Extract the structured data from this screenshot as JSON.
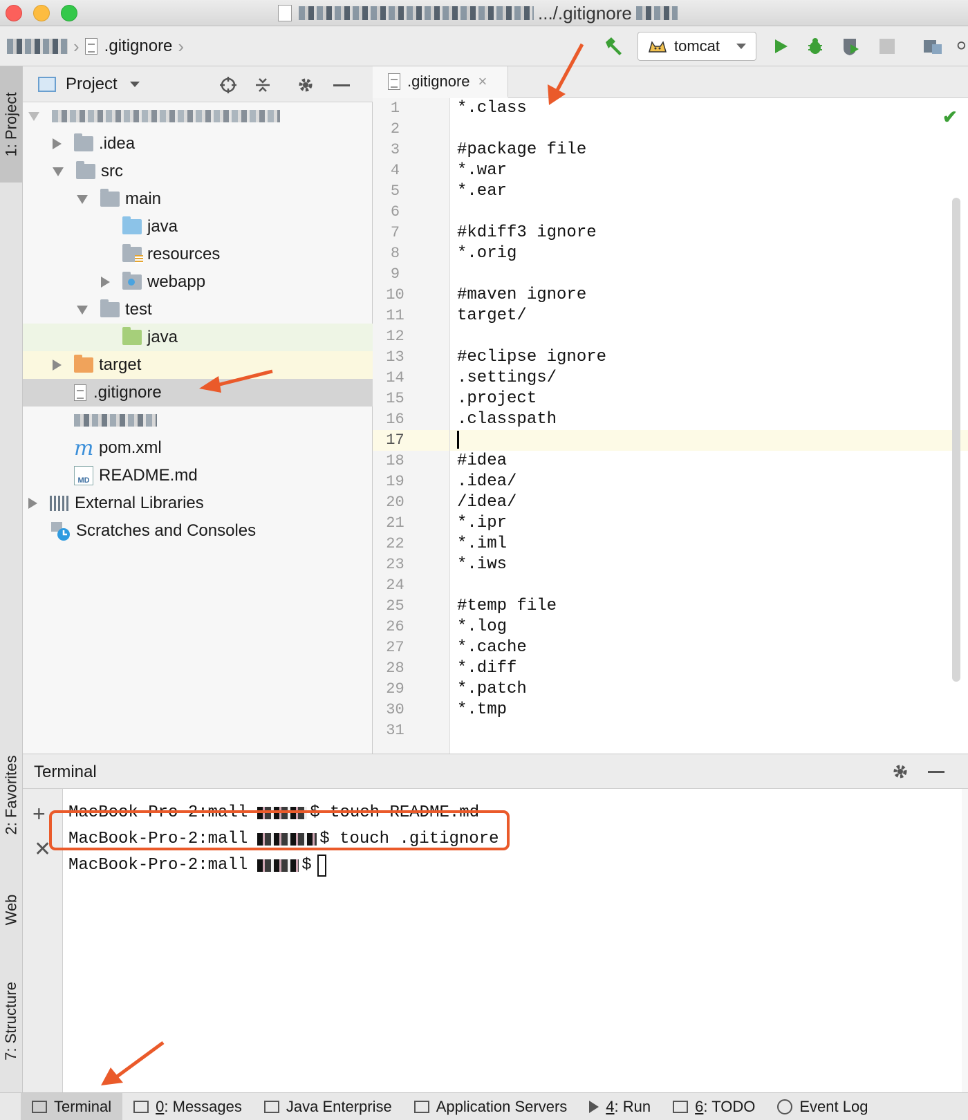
{
  "window": {
    "title": ".../.gitignore"
  },
  "navbar": {
    "breadcrumb_file": ".gitignore",
    "run_config": "tomcat"
  },
  "tool_windows": {
    "left": [
      "1: Project",
      "2: Favorites",
      "Web",
      "7: Structure"
    ]
  },
  "project": {
    "title": "Project",
    "tree": [
      {
        "label": ".idea",
        "depth": 1,
        "expand": "collapsed",
        "icon": "folder-gray"
      },
      {
        "label": "src",
        "depth": 1,
        "expand": "expanded",
        "icon": "folder-gray"
      },
      {
        "label": "main",
        "depth": 2,
        "expand": "expanded",
        "icon": "folder-gray"
      },
      {
        "label": "java",
        "depth": 3,
        "expand": "none",
        "icon": "folder-blue"
      },
      {
        "label": "resources",
        "depth": 3,
        "expand": "none",
        "icon": "folder-resources"
      },
      {
        "label": "webapp",
        "depth": 3,
        "expand": "collapsed",
        "icon": "folder-web"
      },
      {
        "label": "test",
        "depth": 2,
        "expand": "expanded",
        "icon": "folder-gray"
      },
      {
        "label": "java",
        "depth": 3,
        "expand": "none",
        "icon": "folder-green",
        "highlight": "green"
      },
      {
        "label": "target",
        "depth": 1,
        "expand": "collapsed",
        "icon": "folder-orange",
        "highlight": "yellow"
      },
      {
        "label": ".gitignore",
        "depth": 1,
        "expand": "none",
        "icon": "text-file",
        "selected": true
      },
      {
        "label": "",
        "depth": 1,
        "expand": "none",
        "icon": "redacted"
      },
      {
        "label": "pom.xml",
        "depth": 1,
        "expand": "none",
        "icon": "maven"
      },
      {
        "label": "README.md",
        "depth": 1,
        "expand": "none",
        "icon": "markdown"
      },
      {
        "label": "External Libraries",
        "depth": 0,
        "expand": "collapsed",
        "icon": "libraries"
      },
      {
        "label": "Scratches and Consoles",
        "depth": 0,
        "expand": "none",
        "icon": "scratches"
      }
    ]
  },
  "editor": {
    "tab": ".gitignore",
    "current_line": 17,
    "lines": [
      "*.class",
      "",
      "#package file",
      "*.war",
      "*.ear",
      "",
      "#kdiff3 ignore",
      "*.orig",
      "",
      "#maven ignore",
      "target/",
      "",
      "#eclipse ignore",
      ".settings/",
      ".project",
      ".classpath",
      "",
      "#idea",
      ".idea/",
      "/idea/",
      "*.ipr",
      "*.iml",
      "*.iws",
      "",
      "#temp file",
      "*.log",
      "*.cache",
      "*.diff",
      "*.patch",
      "*.tmp",
      ""
    ]
  },
  "terminal": {
    "title": "Terminal",
    "lines": [
      {
        "prompt": "MacBook-Pro-2:mall",
        "tail": "$ touch README.md"
      },
      {
        "prompt": "MacBook-Pro-2:mall",
        "tail": "$ touch .gitignore"
      },
      {
        "prompt": "MacBook-Pro-2:mall",
        "tail": "$"
      }
    ]
  },
  "statusbar": {
    "items": [
      {
        "label": "Terminal",
        "active": true
      },
      {
        "mnemonic": "0",
        "label": ": Messages"
      },
      {
        "label": "Java Enterprise"
      },
      {
        "label": "Application Servers"
      },
      {
        "mnemonic": "4",
        "label": ": Run"
      },
      {
        "mnemonic": "6",
        "label": ": TODO"
      },
      {
        "label": "Event Log"
      }
    ]
  },
  "colors": {
    "annotation": "#ea5a2a",
    "run_green": "#3ca036",
    "selection": "#d4d4d4"
  }
}
